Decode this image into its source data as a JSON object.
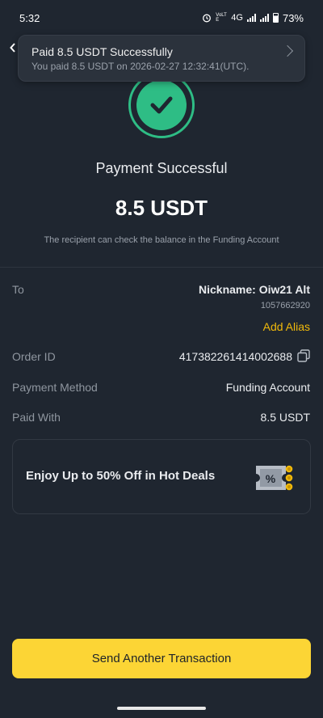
{
  "status_bar": {
    "time": "5:32",
    "network": "4G",
    "volte": "VoLTE",
    "battery_percent": "73%",
    "battery_level": 0.73
  },
  "toast": {
    "title": "Paid 8.5 USDT Successfully",
    "subtitle": "You paid 8.5 USDT on 2026-02-27 12:32:41(UTC)."
  },
  "result": {
    "title": "Payment Successful",
    "amount": "8.5 USDT",
    "note": "The recipient can check the balance in the Funding Account"
  },
  "details": {
    "to_label": "To",
    "nickname": "Nickname: Oiw21 Alt",
    "uid": "1057662920",
    "add_alias": "Add Alias",
    "order_label": "Order ID",
    "order_id": "417382261414002688",
    "payment_method_label": "Payment Method",
    "payment_method": "Funding Account",
    "paid_with_label": "Paid With",
    "paid_with": "8.5 USDT"
  },
  "promo": {
    "text": "Enjoy Up to 50% Off in Hot Deals",
    "icon": "discount-ticket-icon"
  },
  "cta": {
    "label": "Send Another Transaction"
  },
  "colors": {
    "background": "#1f2630",
    "success": "#2ebd85",
    "accent": "#f0b90b",
    "button": "#fcd535"
  }
}
